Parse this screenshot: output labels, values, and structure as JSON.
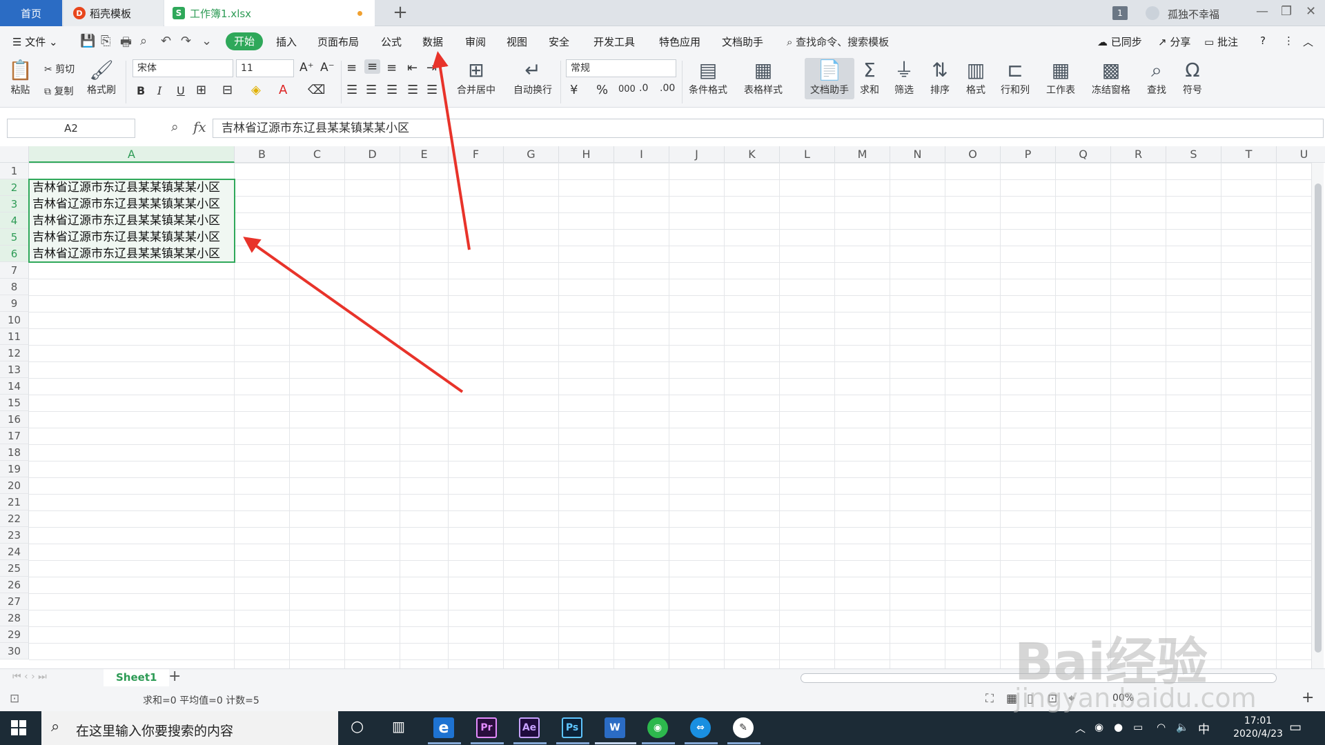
{
  "titlebar": {
    "home_tab": "首页",
    "template_tab": "稻壳模板",
    "template_logo": "D",
    "workbook_tab": "工作簿1.xlsx",
    "workbook_logo": "S",
    "add_tab": "+",
    "window_badge": "1",
    "user_name": "孤独不幸福",
    "minimize": "—",
    "restore": "❐",
    "close": "✕"
  },
  "menubar": {
    "file_label": "文件",
    "items": [
      "开始",
      "插入",
      "页面布局",
      "公式",
      "数据",
      "审阅",
      "视图",
      "安全",
      "开发工具",
      "特色应用",
      "文档助手"
    ],
    "search": "查找命令、搜索模板",
    "sync": "已同步",
    "share": "分享",
    "comment": "批注",
    "help": "?",
    "more": "⋮",
    "collapse": "︿"
  },
  "ribbon": {
    "paste": "粘贴",
    "cut": "剪切",
    "copy": "复制",
    "format_painter": "格式刷",
    "font_name": "宋体",
    "font_size": "11",
    "bold": "B",
    "italic": "I",
    "underline": "U",
    "merge_center": "合并居中",
    "wrap_text": "自动换行",
    "number_format": "常规",
    "percent": "%",
    "thousands": "000",
    "cond_format": "条件格式",
    "table_style": "表格样式",
    "doc_assistant": "文档助手",
    "sum": "求和",
    "filter": "筛选",
    "sort": "排序",
    "format": "格式",
    "rows_cols": "行和列",
    "worksheet": "工作表",
    "freeze": "冻结窗格",
    "find": "查找",
    "symbol": "符号"
  },
  "formula": {
    "name_box": "A2",
    "fx": "fx",
    "content": "吉林省辽源市东辽县某某镇某某小区"
  },
  "grid": {
    "columns": [
      "A",
      "B",
      "C",
      "D",
      "E",
      "F",
      "G",
      "H",
      "I",
      "J",
      "K",
      "L",
      "M",
      "N",
      "O",
      "P",
      "Q",
      "R",
      "S",
      "T",
      "U"
    ],
    "rows": [
      "1",
      "2",
      "3",
      "4",
      "5",
      "6",
      "7",
      "8",
      "9",
      "10",
      "11",
      "12",
      "13",
      "14",
      "15",
      "16",
      "17",
      "18",
      "19",
      "20",
      "21",
      "22",
      "23",
      "24",
      "25",
      "26",
      "27",
      "28",
      "29",
      "30"
    ],
    "cells_a": [
      "吉林省辽源市东辽县某某镇某某小区",
      "吉林省辽源市东辽县某某镇某某小区",
      "吉林省辽源市东辽县某某镇某某小区",
      "吉林省辽源市东辽县某某镇某某小区",
      "吉林省辽源市东辽县某某镇某某小区"
    ]
  },
  "sheets": {
    "active": "Sheet1",
    "add": "+"
  },
  "status": {
    "summary": "求和=0  平均值=0  计数=5",
    "zoom": "00%"
  },
  "taskbar": {
    "search_placeholder": "在这里输入你要搜索的内容",
    "apps": [
      "Pr",
      "Ae",
      "Ps",
      "W"
    ],
    "time": "17:01",
    "date": "2020/4/23",
    "ime": "中"
  },
  "watermark": {
    "brand": "Bai经验",
    "url": "jingyan.baidu.com"
  },
  "colors": {
    "accent_green": "#2fa85a",
    "home_blue": "#2b6cc4",
    "arrow_red": "#e8332a"
  }
}
